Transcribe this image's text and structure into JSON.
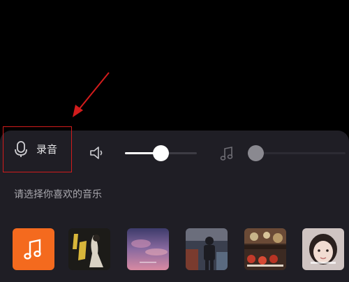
{
  "controls": {
    "record_label": "录音",
    "voice_volume": 0.5,
    "music_volume": 0.0
  },
  "prompt_text": "请选择你喜欢的音乐",
  "music_list": {
    "items": [
      {
        "name": "music-note-tile",
        "icon": "music-note-icon",
        "color": "#f46a1e"
      },
      {
        "name": "album-cover-1",
        "color": "#22201a"
      },
      {
        "name": "album-cover-2",
        "color": "#5b4b7e"
      },
      {
        "name": "album-cover-3",
        "color": "#4a556c"
      },
      {
        "name": "album-cover-4",
        "color": "#5a3a2a"
      },
      {
        "name": "album-cover-5",
        "color": "#c9bfbd"
      }
    ]
  },
  "colors": {
    "panel_bg": "#1f1e25",
    "annotation_red": "#d21c1c",
    "accent_orange": "#f46a1e"
  }
}
